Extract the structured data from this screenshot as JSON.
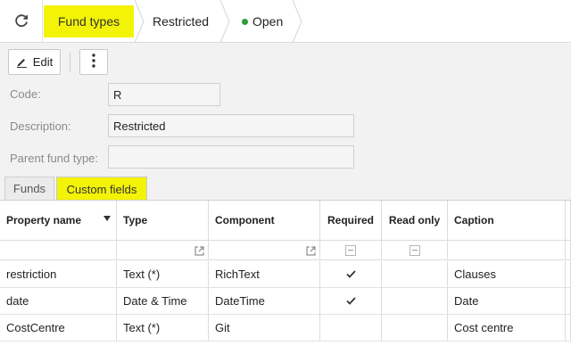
{
  "breadcrumb": {
    "items": [
      "Fund types",
      "Restricted",
      "Open"
    ],
    "status_color": "#2e9a39",
    "highlight_color": "#f3f307"
  },
  "toolbar": {
    "edit_label": "Edit"
  },
  "form": {
    "code_label": "Code:",
    "code_value": "R",
    "description_label": "Description:",
    "description_value": "Restricted",
    "parent_label": "Parent fund type:",
    "parent_value": ""
  },
  "tabs": [
    "Funds",
    "Custom fields"
  ],
  "grid": {
    "columns": [
      "Property name",
      "Type",
      "Component",
      "Required",
      "Read only",
      "Caption"
    ],
    "rows": [
      {
        "property": "restriction",
        "type": "Text (*)",
        "component": "RichText",
        "required": true,
        "read_only": false,
        "caption": "Clauses"
      },
      {
        "property": "date",
        "type": "Date & Time",
        "component": "DateTime",
        "required": true,
        "read_only": false,
        "caption": "Date"
      },
      {
        "property": "CostCentre",
        "type": "Text (*)",
        "component": "Git",
        "required": false,
        "read_only": false,
        "caption": "Cost centre"
      }
    ]
  },
  "icons": {
    "refresh": "refresh-icon",
    "edit": "pencil-icon",
    "more": "vertical-ellipsis-icon",
    "sort": "sort-down-icon",
    "popout": "external-link-icon",
    "check": "checkmark-icon"
  }
}
